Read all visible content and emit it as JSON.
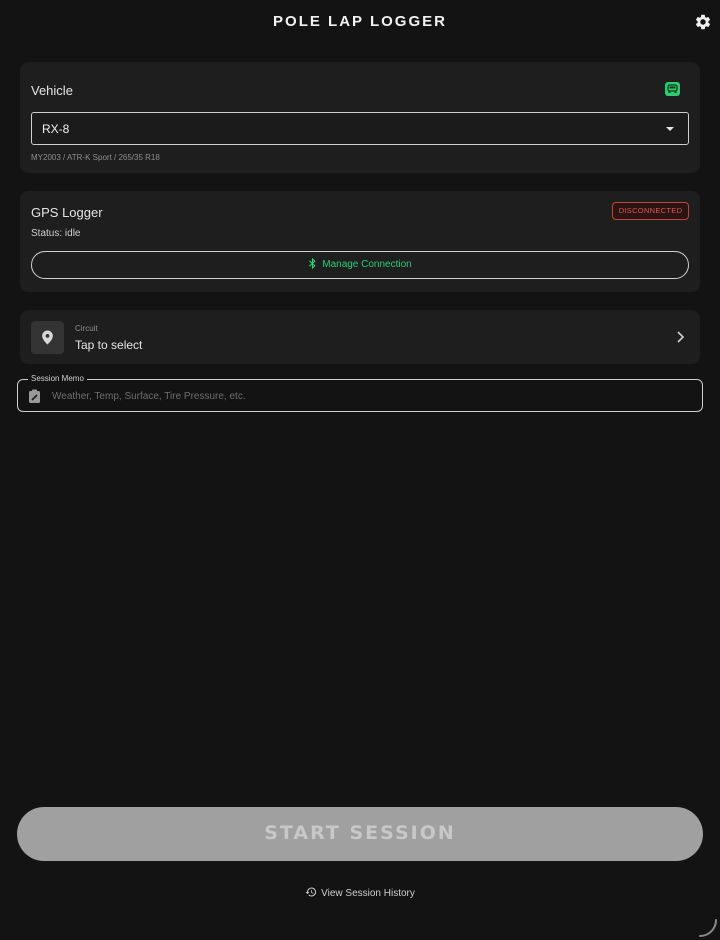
{
  "header": {
    "title": "POLE LAP LOGGER",
    "settings_icon": "gear-icon"
  },
  "vehicle": {
    "title": "Vehicle",
    "badge_icon": "car-icon",
    "badge_color": "#2ecc71",
    "selected": "RX-8",
    "spec": "MY2003 / ATR-K Sport / 265/35 R18"
  },
  "gps": {
    "title": "GPS Logger",
    "status_badge": "DISCONNECTED",
    "status_badge_color": "#e0564c",
    "status_text": "Status: idle",
    "manage_label": "Manage Connection",
    "manage_icon": "bluetooth-icon",
    "accent": "#2ecc71"
  },
  "circuit": {
    "label": "Circuit",
    "value": "Tap to select",
    "icon": "location-pin-icon"
  },
  "memo": {
    "label": "Session Memo",
    "placeholder": "Weather, Temp, Surface, Tire Pressure, etc.",
    "value": ""
  },
  "actions": {
    "start_label": "START SESSION",
    "history_label": "View Session History",
    "history_icon": "history-icon"
  }
}
